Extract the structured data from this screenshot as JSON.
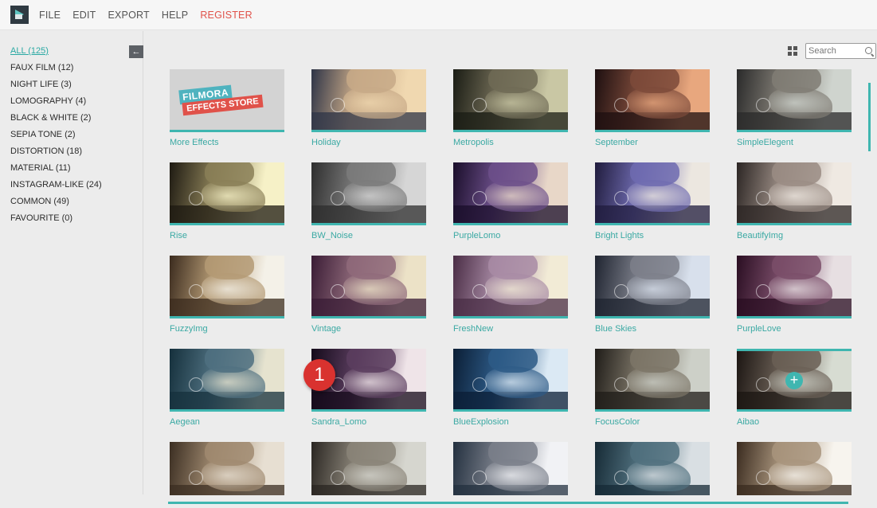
{
  "menu": {
    "items": [
      "FILE",
      "EDIT",
      "EXPORT",
      "HELP"
    ],
    "register": "REGISTER"
  },
  "sidebar": {
    "categories": [
      "ALL (125)",
      "FAUX FILM (12)",
      "NIGHT LIFE (3)",
      "LOMOGRAPHY (4)",
      "BLACK & WHITE (2)",
      "SEPIA TONE (2)",
      "DISTORTION (18)",
      "MATERIAL (11)",
      "INSTAGRAM-LIKE (24)",
      "COMMON (49)",
      "FAVOURITE (0)"
    ],
    "active_index": 0,
    "collapse_icon": "arrow-left-icon"
  },
  "search": {
    "placeholder": "Search",
    "icon": "search-icon"
  },
  "store_card": {
    "line1": "FILMORA",
    "line2": "EFFECTS STORE"
  },
  "effects": [
    {
      "label": "More Effects",
      "store": true
    },
    {
      "label": "Holiday",
      "colors": [
        "#c7a987",
        "#2e3447",
        "#f0d8b0"
      ]
    },
    {
      "label": "Metropolis",
      "colors": [
        "#6f6a55",
        "#1a1c14",
        "#c9c7a4"
      ]
    },
    {
      "label": "September",
      "colors": [
        "#7c4a3a",
        "#1d0f10",
        "#e8a77e"
      ]
    },
    {
      "label": "SimpleElegent",
      "colors": [
        "#807c74",
        "#2a2a2a",
        "#cfd4ce"
      ]
    },
    {
      "label": "Rise",
      "colors": [
        "#8a7f57",
        "#1e1a12",
        "#f6f1c7"
      ]
    },
    {
      "label": "BW_Noise",
      "colors": [
        "#7b7b7b",
        "#2e2e2e",
        "#d6d6d6"
      ]
    },
    {
      "label": "PurpleLomo",
      "colors": [
        "#6c4f8a",
        "#1a0e2a",
        "#e8d7c8"
      ]
    },
    {
      "label": "Bright Lights",
      "colors": [
        "#6f6bb0",
        "#201c3d",
        "#ece7e0"
      ]
    },
    {
      "label": "BeautifyImg",
      "colors": [
        "#9a8c84",
        "#2c2624",
        "#efe9e2"
      ]
    },
    {
      "label": "FuzzyImg",
      "colors": [
        "#b49a74",
        "#3b2b1e",
        "#f4f1e8"
      ]
    },
    {
      "label": "Vintage",
      "colors": [
        "#8f6a7a",
        "#3a1c35",
        "#ece2c7"
      ]
    },
    {
      "label": "FreshNew",
      "colors": [
        "#a88ba5",
        "#4a2d45",
        "#f2ebd6"
      ]
    },
    {
      "label": "Blue Skies",
      "colors": [
        "#7c7f8a",
        "#1f2430",
        "#d8e0ec"
      ]
    },
    {
      "label": "PurpleLove",
      "colors": [
        "#7a4d69",
        "#2a0e22",
        "#e7dfe2"
      ]
    },
    {
      "label": "Aegean",
      "colors": [
        "#4f7080",
        "#15303c",
        "#e6e3cf"
      ]
    },
    {
      "label": "Sandra_Lomo",
      "colors": [
        "#5a3d5e",
        "#140a1a",
        "#efe4e8"
      ]
    },
    {
      "label": "BlueExplosion",
      "colors": [
        "#2d5a86",
        "#0b1e35",
        "#dbe9f4"
      ]
    },
    {
      "label": "FocusColor",
      "colors": [
        "#7c7567",
        "#1f1c18",
        "#cdd0c8"
      ]
    },
    {
      "label": "Aibao",
      "colors": [
        "#6a5f55",
        "#1b1512",
        "#d7dcd2"
      ]
    },
    {
      "label": "",
      "colors": [
        "#a08a70",
        "#3b2e22",
        "#e7dfd2"
      ]
    },
    {
      "label": "",
      "colors": [
        "#8a8478",
        "#2a2622",
        "#d6d6cf"
      ]
    },
    {
      "label": "",
      "colors": [
        "#7a7f8a",
        "#23303f",
        "#f1f2f5"
      ]
    },
    {
      "label": "",
      "colors": [
        "#50707e",
        "#162a35",
        "#d9dfe3"
      ]
    },
    {
      "label": "",
      "colors": [
        "#a8947c",
        "#3a2b1f",
        "#f7f4ee"
      ]
    }
  ],
  "step_badge": "1",
  "add_icon": "plus-icon",
  "view_toggle_icon": "grid-view-icon"
}
